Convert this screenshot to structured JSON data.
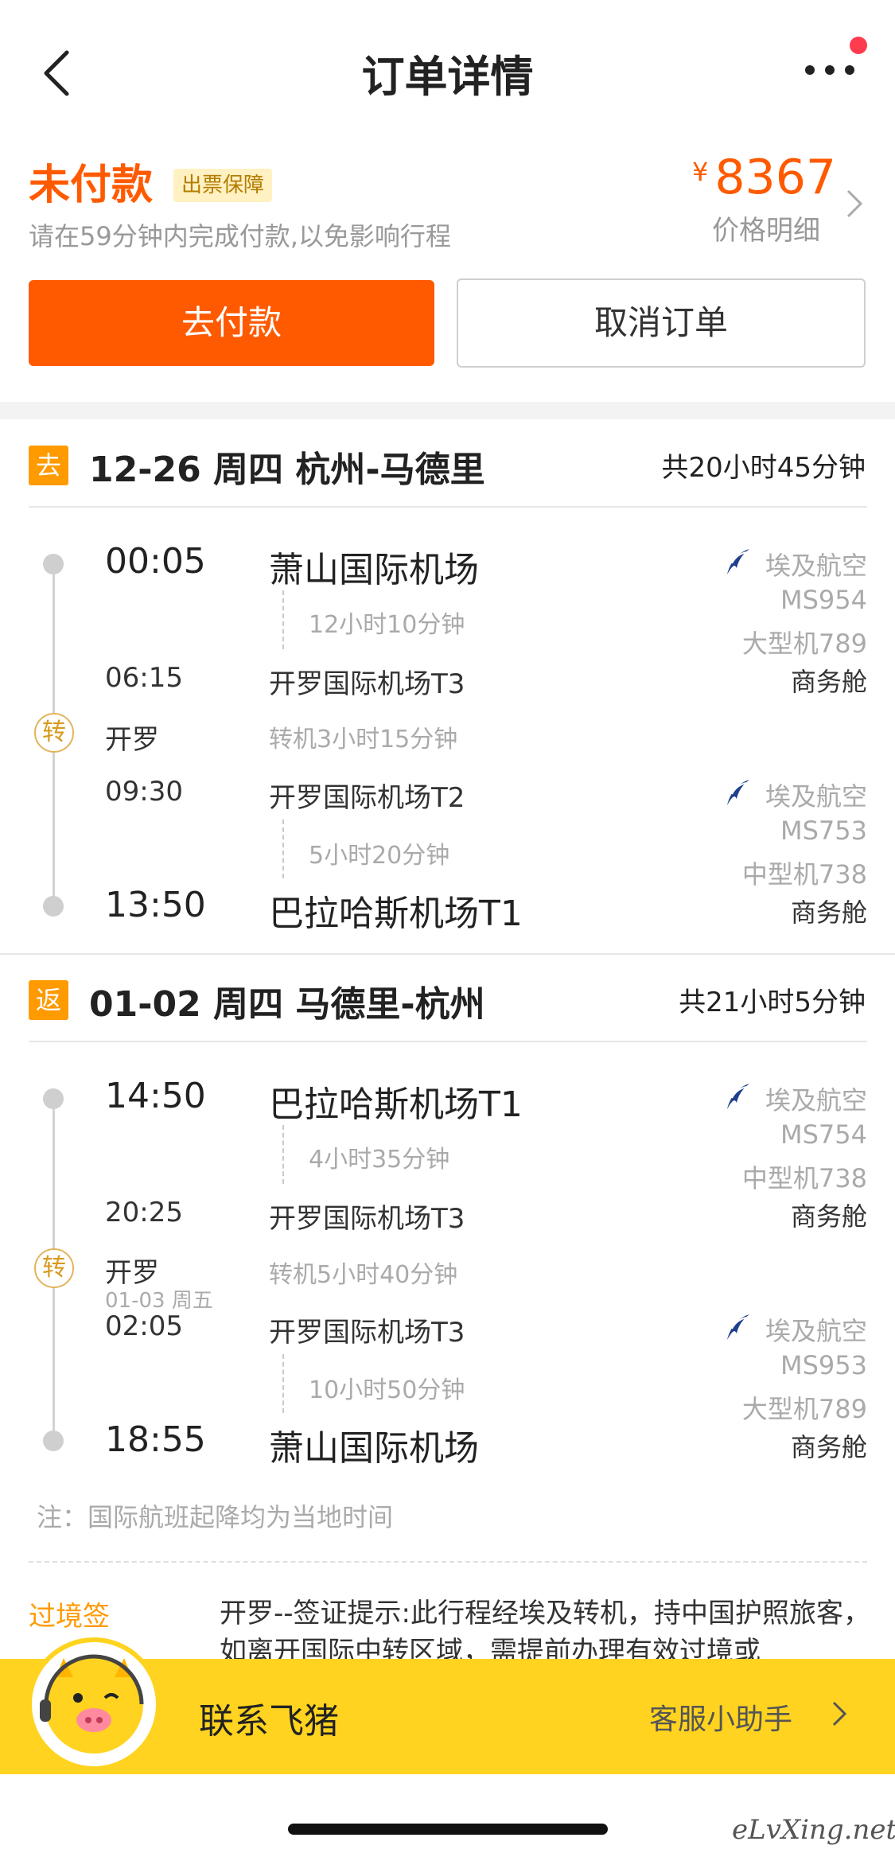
{
  "nav": {
    "title": "订单详情"
  },
  "status": {
    "title": "未付款",
    "badge": "出票保障",
    "subtitle": "请在59分钟内完成付款,以免影响行程",
    "currency": "¥",
    "price": "8367",
    "price_detail": "价格明细"
  },
  "actions": {
    "pay": "去付款",
    "cancel": "取消订单"
  },
  "outbound": {
    "tag": "去",
    "title": "12-26 周四 杭州-马德里",
    "total": "共20小时45分钟",
    "leg1": {
      "dep_time": "00:05",
      "dep_airport": "萧山国际机场",
      "duration": "12小时10分钟",
      "arr_time": "06:15",
      "arr_airport": "开罗国际机场T3",
      "airline": "埃及航空",
      "flight": "MS954",
      "aircraft": "大型机789",
      "cabin": "商务舱"
    },
    "transfer": {
      "icon_label": "转",
      "city": "开罗",
      "duration": "转机3小时15分钟"
    },
    "leg2": {
      "dep_time": "09:30",
      "dep_airport": "开罗国际机场T2",
      "duration": "5小时20分钟",
      "arr_time": "13:50",
      "arr_airport": "巴拉哈斯机场T1",
      "airline": "埃及航空",
      "flight": "MS753",
      "aircraft": "中型机738",
      "cabin": "商务舱"
    }
  },
  "return": {
    "tag": "返",
    "title": "01-02 周四 马德里-杭州",
    "total": "共21小时5分钟",
    "leg1": {
      "dep_time": "14:50",
      "dep_airport": "巴拉哈斯机场T1",
      "duration": "4小时35分钟",
      "arr_time": "20:25",
      "arr_airport": "开罗国际机场T3",
      "airline": "埃及航空",
      "flight": "MS754",
      "aircraft": "中型机738",
      "cabin": "商务舱"
    },
    "transfer": {
      "icon_label": "转",
      "city": "开罗",
      "date": "01-03 周五",
      "duration": "转机5小时40分钟"
    },
    "leg2": {
      "dep_time": "02:05",
      "dep_airport": "开罗国际机场T3",
      "duration": "10小时50分钟",
      "arr_time": "18:55",
      "arr_airport": "萧山国际机场",
      "airline": "埃及航空",
      "flight": "MS953",
      "aircraft": "大型机789",
      "cabin": "商务舱"
    }
  },
  "note": "注：国际航班起降均为当地时间",
  "visa": {
    "label": "过境签",
    "text": "开罗--签证提示:此行程经埃及转机，持中国护照旅客，如离开国际中转区域，需提前办理有效过境或"
  },
  "contact": {
    "label": "联系飞猪",
    "assistant": "客服小助手"
  },
  "watermark": "eLvXing.net",
  "colors": {
    "accent": "#ff5a00",
    "tag": "#ff9a00",
    "contact_bar": "#ffd31f"
  }
}
